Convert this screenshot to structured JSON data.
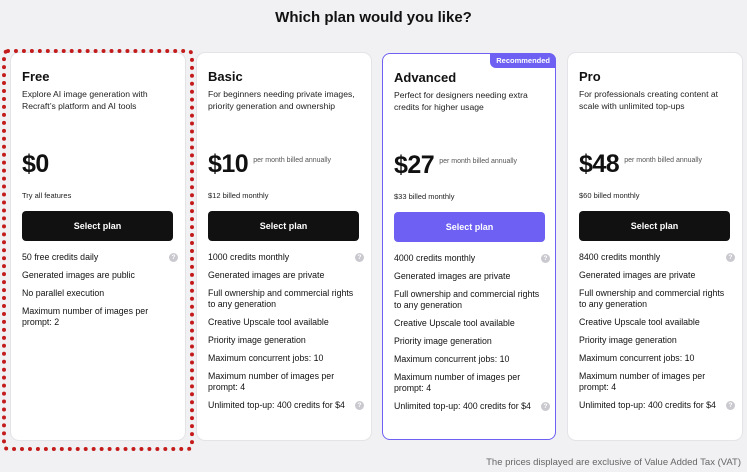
{
  "page": {
    "title": "Which plan would you like?",
    "footnote": "The prices displayed are exclusive of Value Added Tax (VAT)"
  },
  "colors": {
    "accent": "#6d60f2",
    "dark_button": "#111111",
    "selection_outline": "#c41c1c"
  },
  "plans": [
    {
      "name": "Free",
      "description": "Explore AI image generation with Recraft’s platform and AI tools",
      "price": "$0",
      "period": "",
      "billing": "Try all features",
      "button": "Select plan",
      "features": [
        "50 free credits daily",
        "Generated images are public",
        "No parallel execution",
        "Maximum number of images per prompt: 2"
      ]
    },
    {
      "name": "Basic",
      "description": "For beginners needing private images, priority generation and ownership",
      "price": "$10",
      "period": "per month billed annually",
      "billing": "$12 billed monthly",
      "button": "Select plan",
      "features": [
        "1000 credits monthly",
        "Generated images are private",
        "Full ownership and commercial rights to any generation",
        "Creative Upscale tool available",
        "Priority image generation",
        "Maximum concurrent jobs: 10",
        "Maximum number of images per prompt: 4",
        "Unlimited top-up: 400 credits for $4"
      ]
    },
    {
      "name": "Advanced",
      "badge": "Recommended",
      "description": "Perfect for designers needing extra credits for higher usage",
      "price": "$27",
      "period": "per month billed annually",
      "billing": "$33 billed monthly",
      "button": "Select plan",
      "features": [
        "4000 credits monthly",
        "Generated images are private",
        "Full ownership and commercial rights to any generation",
        "Creative Upscale tool available",
        "Priority image generation",
        "Maximum concurrent jobs: 10",
        "Maximum number of images per prompt: 4",
        "Unlimited top-up: 400 credits for $4"
      ]
    },
    {
      "name": "Pro",
      "description": "For professionals creating content at scale with unlimited top-ups",
      "price": "$48",
      "period": "per month billed annually",
      "billing": "$60 billed monthly",
      "button": "Select plan",
      "features": [
        "8400 credits monthly",
        "Generated images are private",
        "Full ownership and commercial rights to any generation",
        "Creative Upscale tool available",
        "Priority image generation",
        "Maximum concurrent jobs: 10",
        "Maximum number of images per prompt: 4",
        "Unlimited top-up: 400 credits for $4"
      ]
    }
  ],
  "icons": {
    "info": "info-icon"
  }
}
